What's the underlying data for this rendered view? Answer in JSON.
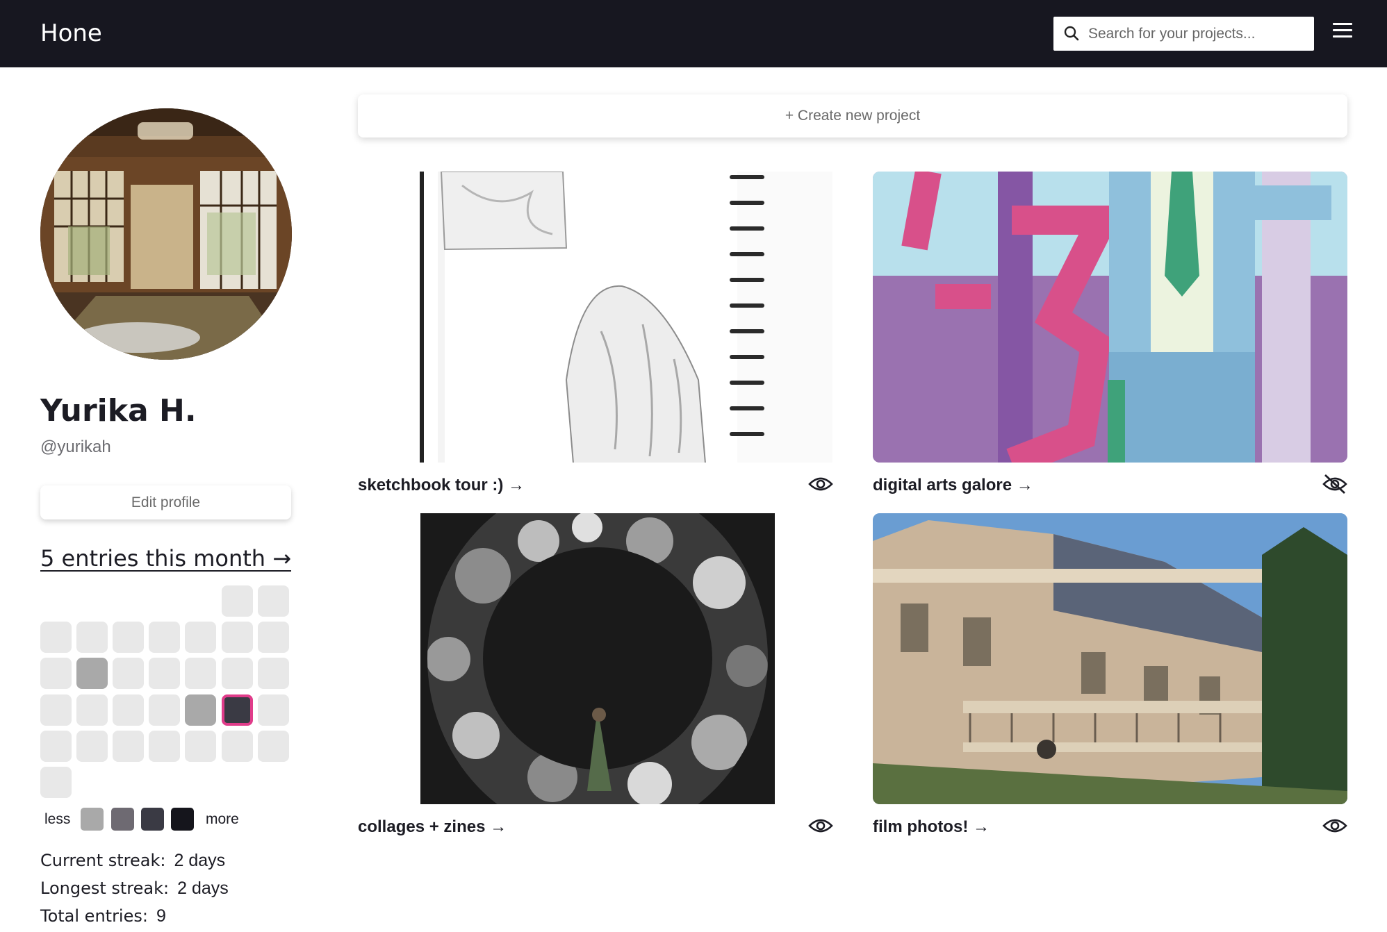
{
  "app": {
    "logo": "Hone",
    "search_placeholder": "Search for your projects...",
    "search_icon": "search-icon",
    "menu_icon": "hamburger-menu-icon"
  },
  "profile": {
    "name": "Yurika H.",
    "handle": "@yurikah",
    "edit_label": "Edit profile",
    "entries_link": "5 entries this month →"
  },
  "activity": {
    "legend_less": "less",
    "legend_more": "more",
    "legend_colors": [
      "#a9a9a9",
      "#6e6a72",
      "#3a3a44",
      "#15151c"
    ],
    "today_color": "#e03c8a"
  },
  "stats": [
    {
      "label": "Current streak:",
      "value": "2 days"
    },
    {
      "label": "Longest streak:",
      "value": "2 days"
    },
    {
      "label": "Total entries:",
      "value": "9"
    }
  ],
  "main": {
    "create_label": "+ Create new project",
    "projects": [
      {
        "title": "sketchbook tour :) →",
        "visibility": "visible",
        "visibility_icon": "eye-icon"
      },
      {
        "title": "digital arts galore →",
        "visibility": "hidden",
        "visibility_icon": "eye-off-icon"
      },
      {
        "title": "collages + zines →",
        "visibility": "visible",
        "visibility_icon": "eye-icon"
      },
      {
        "title": "film photos! →",
        "visibility": "visible",
        "visibility_icon": "eye-icon"
      }
    ]
  }
}
